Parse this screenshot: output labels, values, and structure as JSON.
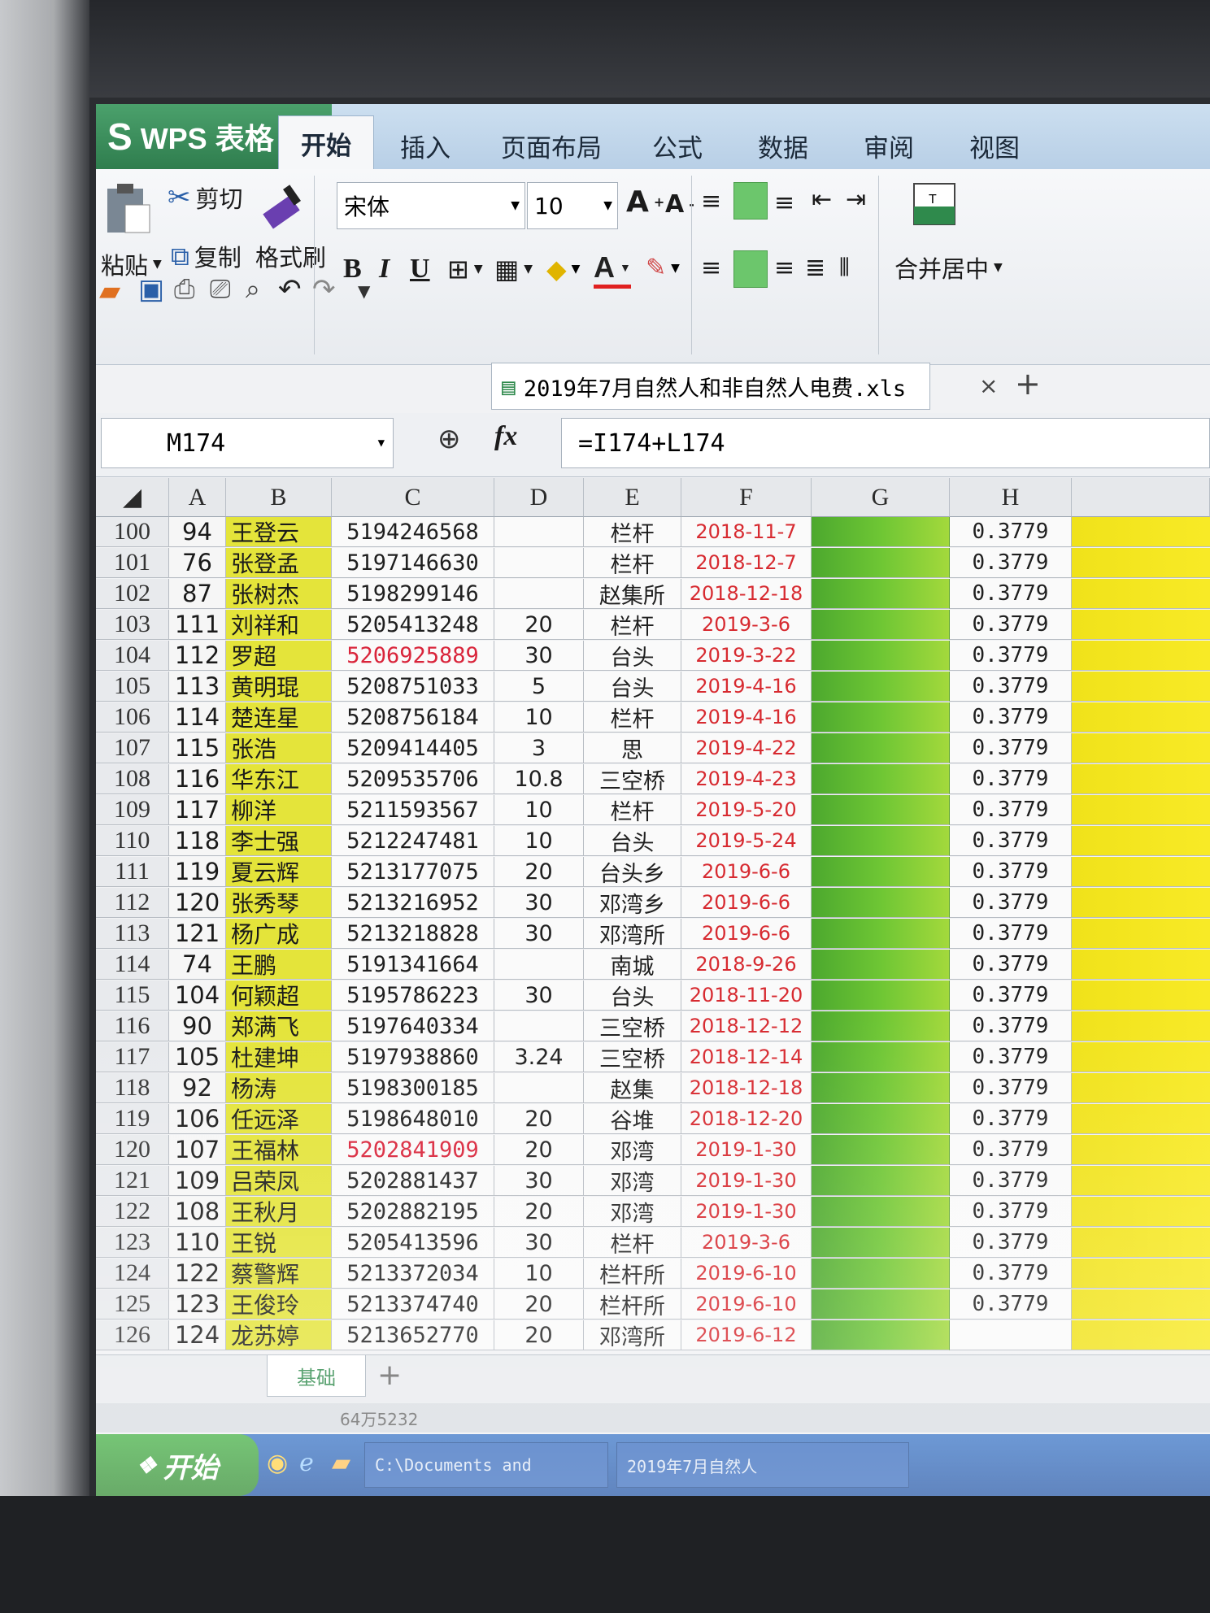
{
  "app": {
    "name": "WPS 表格"
  },
  "tabs": [
    "开始",
    "插入",
    "页面布局",
    "公式",
    "数据",
    "审阅",
    "视图"
  ],
  "ribbon": {
    "paste": "粘贴",
    "cut": "剪切",
    "copy": "复制",
    "format_painter": "格式刷",
    "font_name": "宋体",
    "font_size": "10",
    "bold": "B",
    "italic": "I",
    "underline": "U",
    "merge_center": "合并居中"
  },
  "file_tab": {
    "name": "2019年7月自然人和非自然人电费.xls",
    "close": "×",
    "add": "+"
  },
  "formula_bar": {
    "name_box": "M174",
    "fx": "fx",
    "formula": "=I174+L174"
  },
  "columns": [
    "A",
    "B",
    "C",
    "D",
    "E",
    "F",
    "G",
    "H"
  ],
  "rows": [
    {
      "n": "100",
      "a": "94",
      "b": "王登云",
      "c": "5194246568",
      "cred": false,
      "d": "",
      "e": "栏杆",
      "f": "2018-11-7",
      "h": "0.3779"
    },
    {
      "n": "101",
      "a": "76",
      "b": "张登孟",
      "c": "5197146630",
      "cred": false,
      "d": "",
      "e": "栏杆",
      "f": "2018-12-7",
      "h": "0.3779"
    },
    {
      "n": "102",
      "a": "87",
      "b": "张树杰",
      "c": "5198299146",
      "cred": false,
      "d": "",
      "e": "赵集所",
      "f": "2018-12-18",
      "h": "0.3779"
    },
    {
      "n": "103",
      "a": "111",
      "b": "刘祥和",
      "c": "5205413248",
      "cred": false,
      "d": "20",
      "e": "栏杆",
      "f": "2019-3-6",
      "h": "0.3779"
    },
    {
      "n": "104",
      "a": "112",
      "b": "罗超",
      "c": "5206925889",
      "cred": true,
      "d": "30",
      "e": "台头",
      "f": "2019-3-22",
      "h": "0.3779"
    },
    {
      "n": "105",
      "a": "113",
      "b": "黄明琨",
      "c": "5208751033",
      "cred": false,
      "d": "5",
      "e": "台头",
      "f": "2019-4-16",
      "h": "0.3779"
    },
    {
      "n": "106",
      "a": "114",
      "b": "楚连星",
      "c": "5208756184",
      "cred": false,
      "d": "10",
      "e": "栏杆",
      "f": "2019-4-16",
      "h": "0.3779"
    },
    {
      "n": "107",
      "a": "115",
      "b": "张浩",
      "c": "5209414405",
      "cred": false,
      "d": "3",
      "e": "思",
      "f": "2019-4-22",
      "h": "0.3779"
    },
    {
      "n": "108",
      "a": "116",
      "b": "华东江",
      "c": "5209535706",
      "cred": false,
      "d": "10.8",
      "e": "三空桥",
      "f": "2019-4-23",
      "h": "0.3779"
    },
    {
      "n": "109",
      "a": "117",
      "b": "柳洋",
      "c": "5211593567",
      "cred": false,
      "d": "10",
      "e": "栏杆",
      "f": "2019-5-20",
      "h": "0.3779"
    },
    {
      "n": "110",
      "a": "118",
      "b": "李士强",
      "c": "5212247481",
      "cred": false,
      "d": "10",
      "e": "台头",
      "f": "2019-5-24",
      "h": "0.3779"
    },
    {
      "n": "111",
      "a": "119",
      "b": "夏云辉",
      "c": "5213177075",
      "cred": false,
      "d": "20",
      "e": "台头乡",
      "f": "2019-6-6",
      "h": "0.3779"
    },
    {
      "n": "112",
      "a": "120",
      "b": "张秀琴",
      "c": "5213216952",
      "cred": false,
      "d": "30",
      "e": "邓湾乡",
      "f": "2019-6-6",
      "h": "0.3779"
    },
    {
      "n": "113",
      "a": "121",
      "b": "杨广成",
      "c": "5213218828",
      "cred": false,
      "d": "30",
      "e": "邓湾所",
      "f": "2019-6-6",
      "h": "0.3779"
    },
    {
      "n": "114",
      "a": "74",
      "b": "王鹏",
      "c": "5191341664",
      "cred": false,
      "d": "",
      "e": "南城",
      "f": "2018-9-26",
      "h": "0.3779"
    },
    {
      "n": "115",
      "a": "104",
      "b": "何颖超",
      "c": "5195786223",
      "cred": false,
      "d": "30",
      "e": "台头",
      "f": "2018-11-20",
      "h": "0.3779"
    },
    {
      "n": "116",
      "a": "90",
      "b": "郑满飞",
      "c": "5197640334",
      "cred": false,
      "d": "",
      "e": "三空桥",
      "f": "2018-12-12",
      "h": "0.3779"
    },
    {
      "n": "117",
      "a": "105",
      "b": "杜建坤",
      "c": "5197938860",
      "cred": false,
      "d": "3.24",
      "e": "三空桥",
      "f": "2018-12-14",
      "h": "0.3779"
    },
    {
      "n": "118",
      "a": "92",
      "b": "杨涛",
      "c": "5198300185",
      "cred": false,
      "d": "",
      "e": "赵集",
      "f": "2018-12-18",
      "h": "0.3779"
    },
    {
      "n": "119",
      "a": "106",
      "b": "任远泽",
      "c": "5198648010",
      "cred": false,
      "d": "20",
      "e": "谷堆",
      "f": "2018-12-20",
      "h": "0.3779"
    },
    {
      "n": "120",
      "a": "107",
      "b": "王福林",
      "c": "5202841909",
      "cred": true,
      "d": "20",
      "e": "邓湾",
      "f": "2019-1-30",
      "h": "0.3779"
    },
    {
      "n": "121",
      "a": "109",
      "b": "吕荣凤",
      "c": "5202881437",
      "cred": false,
      "d": "30",
      "e": "邓湾",
      "f": "2019-1-30",
      "h": "0.3779"
    },
    {
      "n": "122",
      "a": "108",
      "b": "王秋月",
      "c": "5202882195",
      "cred": false,
      "d": "20",
      "e": "邓湾",
      "f": "2019-1-30",
      "h": "0.3779"
    },
    {
      "n": "123",
      "a": "110",
      "b": "王锐",
      "c": "5205413596",
      "cred": false,
      "d": "30",
      "e": "栏杆",
      "f": "2019-3-6",
      "h": "0.3779"
    },
    {
      "n": "124",
      "a": "122",
      "b": "蔡警辉",
      "c": "5213372034",
      "cred": false,
      "d": "10",
      "e": "栏杆所",
      "f": "2019-6-10",
      "h": "0.3779"
    },
    {
      "n": "125",
      "a": "123",
      "b": "王俊玲",
      "c": "5213374740",
      "cred": false,
      "d": "20",
      "e": "栏杆所",
      "f": "2019-6-10",
      "h": "0.3779"
    },
    {
      "n": "126",
      "a": "124",
      "b": "龙苏婷",
      "c": "5213652770",
      "cred": false,
      "d": "20",
      "e": "邓湾所",
      "f": "2019-6-12",
      "h": ""
    }
  ],
  "sheet_tabs": {
    "active": "基础",
    "add": "+"
  },
  "status": {
    "text": "64万5232"
  },
  "taskbar": {
    "start": "开始",
    "task1": "C:\\Documents and",
    "task2": "2019年7月自然人"
  },
  "colors": {
    "name_cell": "#e4e43a",
    "gradient_green": "#6ec634",
    "yellow_col": "#f0e21a",
    "red_text": "#d9243a"
  }
}
